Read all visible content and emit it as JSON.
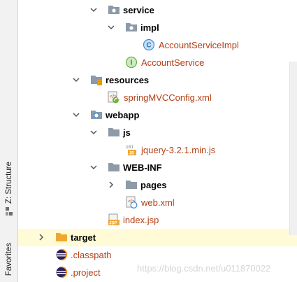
{
  "side_tabs": {
    "structure": "Z: Structure",
    "favorites": "Favorites"
  },
  "tree": [
    {
      "label": "service",
      "icon": "package-folder-icon",
      "expanded": true,
      "style": "bold"
    },
    {
      "label": "impl",
      "icon": "package-folder-icon",
      "expanded": true,
      "style": "bold"
    },
    {
      "label": "AccountServiceImpl",
      "icon": "java-class-icon",
      "style": "brown"
    },
    {
      "label": "AccountService",
      "icon": "java-interface-icon",
      "style": "brown"
    },
    {
      "label": "resources",
      "icon": "resources-folder-icon",
      "expanded": true,
      "style": "bold"
    },
    {
      "label": "springMVCConfig.xml",
      "icon": "spring-xml-icon",
      "style": "brown"
    },
    {
      "label": "webapp",
      "icon": "web-folder-icon",
      "expanded": true,
      "style": "bold"
    },
    {
      "label": "js",
      "icon": "folder-icon",
      "expanded": true,
      "style": "bold"
    },
    {
      "label": "jquery-3.2.1.min.js",
      "icon": "js-file-icon",
      "style": "brown"
    },
    {
      "label": "WEB-INF",
      "icon": "folder-icon",
      "expanded": true,
      "style": "bold"
    },
    {
      "label": "pages",
      "icon": "folder-icon",
      "expanded": false,
      "style": "bold"
    },
    {
      "label": "web.xml",
      "icon": "web-xml-icon",
      "style": "brown"
    },
    {
      "label": "index.jsp",
      "icon": "jsp-file-icon",
      "style": "brown"
    },
    {
      "label": "target",
      "icon": "excluded-folder-icon",
      "expanded": false,
      "style": "bold",
      "selected": true
    },
    {
      "label": ".classpath",
      "icon": "eclipse-file-icon",
      "style": "brown"
    },
    {
      "label": ".project",
      "icon": "eclipse-file-icon",
      "style": "brown"
    }
  ],
  "watermark": "https://blog.csdn.net/u011870022",
  "colors": {
    "file_text": "#b33e14",
    "selection": "#fffbd7",
    "folder": "#8d9aa7",
    "orange_folder": "#f0a732",
    "class_icon": "#3e8fd8",
    "interface_icon": "#62b543"
  }
}
